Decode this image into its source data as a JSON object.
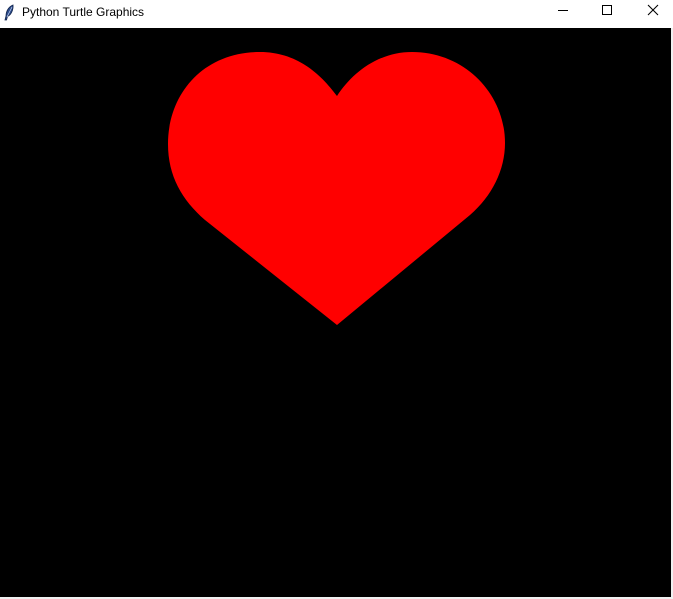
{
  "window": {
    "title": "Python Turtle Graphics",
    "icon": "feather-icon"
  },
  "controls": {
    "minimize_icon": "minimize-icon",
    "maximize_icon": "maximize-icon",
    "close_icon": "close-icon"
  },
  "canvas": {
    "background_color": "#000000",
    "shape": "heart",
    "fill_color": "#ff0000"
  }
}
